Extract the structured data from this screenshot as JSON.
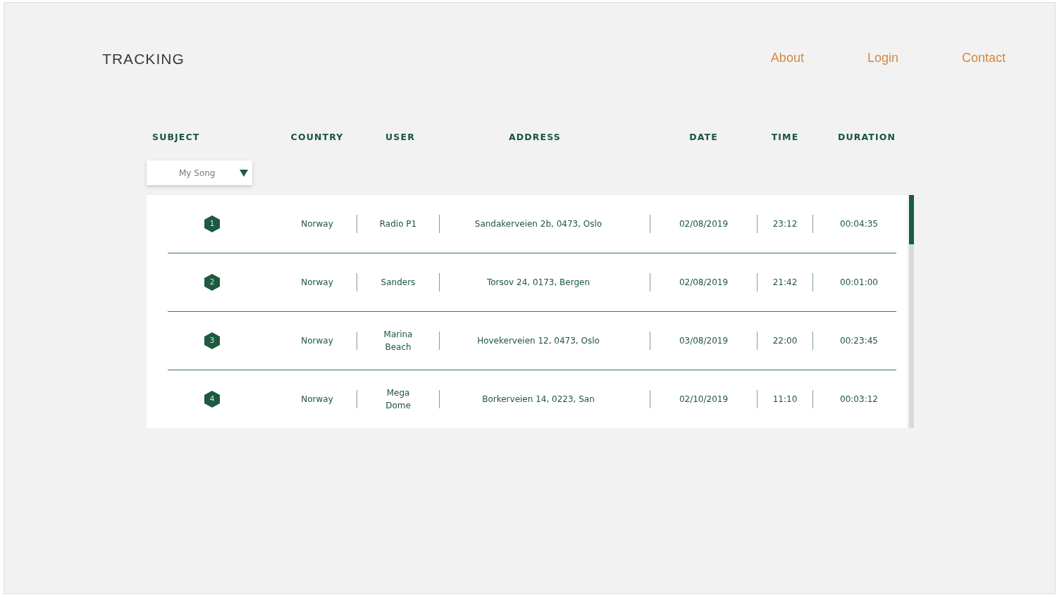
{
  "logo": "TRACKING",
  "nav": [
    "About",
    "Login",
    "Contact"
  ],
  "table": {
    "columns": [
      "SUBJECT",
      "COUNTRY",
      "USER",
      "ADDRESS",
      "DATE",
      "TIME",
      "DURATION"
    ],
    "subject_filter": {
      "value": "My Song"
    },
    "rows": [
      {
        "number": "1",
        "country": "Norway",
        "user": "Radio P1",
        "address": "Sandakerveien 2b, 0473, Oslo",
        "date": "02/08/2019",
        "time": "23:12",
        "duration": "00:04:35"
      },
      {
        "number": "2",
        "country": "Norway",
        "user": "Sanders",
        "address": "Torsov 24, 0173, Bergen",
        "date": "02/08/2019",
        "time": "21:42",
        "duration": "00:01:00"
      },
      {
        "number": "3",
        "country": "Norway",
        "user": "Marina Beach",
        "address": "Hovekerveien 12, 0473, Oslo",
        "date": "03/08/2019",
        "time": "22:00",
        "duration": "00:23:45"
      },
      {
        "number": "4",
        "country": "Norway",
        "user": "Mega Dome",
        "address": "Borkerveien 14, 0223, San",
        "date": "02/10/2019",
        "time": "11:10",
        "duration": "00:03:12"
      }
    ]
  }
}
